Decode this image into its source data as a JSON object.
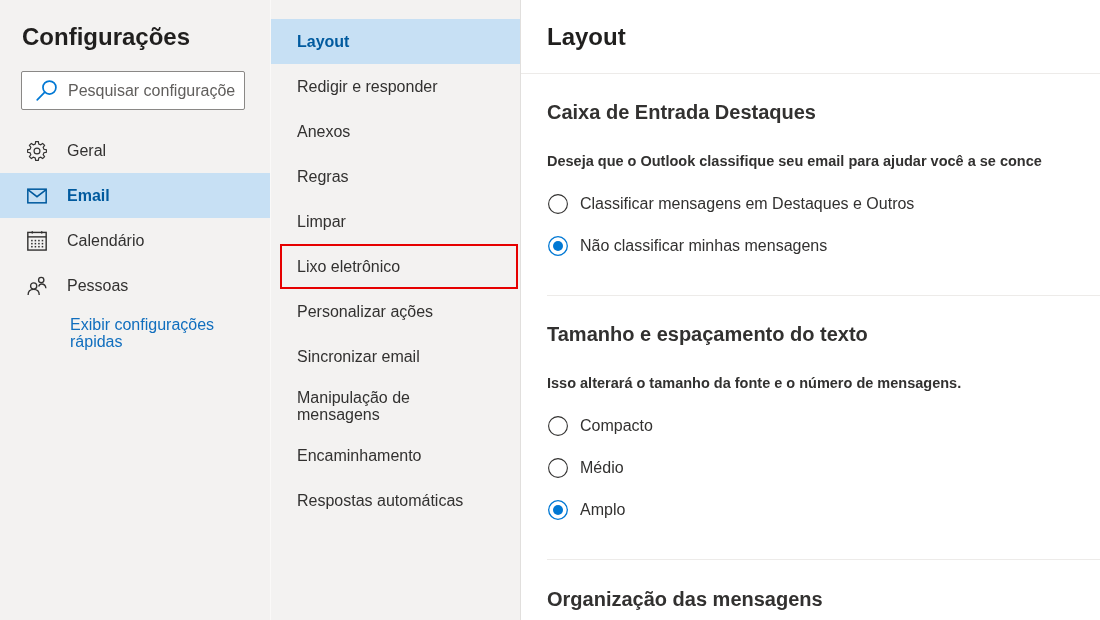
{
  "sidebar": {
    "title": "Configurações",
    "search": {
      "placeholder": "Pesquisar configuraçõe"
    },
    "items": [
      {
        "label": "Geral",
        "kind": "settings",
        "selected": false
      },
      {
        "label": "Email",
        "kind": "mail",
        "selected": true
      },
      {
        "label": "Calendário",
        "kind": "calendar",
        "selected": false
      },
      {
        "label": "Pessoas",
        "kind": "people",
        "selected": false
      }
    ],
    "link": "Exibir configurações rápidas"
  },
  "submenu": {
    "items": [
      {
        "label": "Layout",
        "selected": true,
        "highlighted": false
      },
      {
        "label": "Redigir e responder",
        "selected": false,
        "highlighted": false
      },
      {
        "label": "Anexos",
        "selected": false,
        "highlighted": false
      },
      {
        "label": "Regras",
        "selected": false,
        "highlighted": false
      },
      {
        "label": "Limpar",
        "selected": false,
        "highlighted": false
      },
      {
        "label": "Lixo eletrônico",
        "selected": false,
        "highlighted": true
      },
      {
        "label": "Personalizar ações",
        "selected": false,
        "highlighted": false
      },
      {
        "label": "Sincronizar email",
        "selected": false,
        "highlighted": false
      },
      {
        "label": "Manipulação de mensagens",
        "selected": false,
        "highlighted": false
      },
      {
        "label": "Encaminhamento",
        "selected": false,
        "highlighted": false
      },
      {
        "label": "Respostas automáticas",
        "selected": false,
        "highlighted": false
      }
    ]
  },
  "content": {
    "title": "Layout",
    "sections": [
      {
        "heading": "Caixa de Entrada Destaques",
        "description": "Deseja que o Outlook classifique seu email para ajudar você a se conce",
        "options": [
          {
            "label": "Classificar mensagens em Destaques e Outros",
            "selected": false
          },
          {
            "label": "Não classificar minhas mensagens",
            "selected": true
          }
        ]
      },
      {
        "heading": "Tamanho e espaçamento do texto",
        "description": "Isso alterará o tamanho da fonte e o número de mensagens.",
        "options": [
          {
            "label": "Compacto",
            "selected": false
          },
          {
            "label": "Médio",
            "selected": false
          },
          {
            "label": "Amplo",
            "selected": true
          }
        ]
      },
      {
        "heading": "Organização das mensagens"
      }
    ]
  }
}
